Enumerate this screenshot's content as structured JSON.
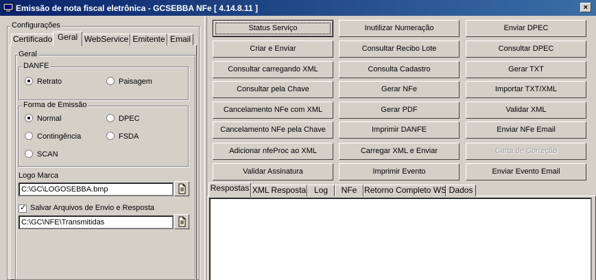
{
  "window": {
    "title": "Emissão de nota fiscal eletrônica - GCSEBBA NFe [ 4.14.8.11 ]",
    "close_glyph": "×"
  },
  "config": {
    "group_label": "Configurações",
    "tabs": [
      "Certificado",
      "Geral",
      "WebService",
      "Emitente",
      "Email"
    ],
    "active_tab": "Geral",
    "geral": {
      "group_label": "Geral",
      "danfe": {
        "label": "DANFE",
        "options": [
          "Retrato",
          "Paisagem"
        ],
        "selected": "Retrato"
      },
      "forma_emissao": {
        "label": "Forma de Emissão",
        "options": [
          "Normal",
          "DPEC",
          "Contingência",
          "FSDA",
          "SCAN"
        ],
        "selected": "Normal"
      },
      "logo_marca": {
        "label": "Logo Marca",
        "value": "C:\\GC\\LOGOSEBBA.bmp"
      },
      "salvar_arquivos": {
        "label": "Salvar Arquivos de Envio e Resposta",
        "checked": true,
        "value": "C:\\GC\\NFE\\Transmitidas"
      }
    }
  },
  "actions": {
    "buttons": [
      "Status Serviço",
      "Inutilizar Numeração",
      "Enviar DPEC",
      "Criar e Enviar",
      "Consultar Recibo Lote",
      "Consultar DPEC",
      "Consultar carregando XML",
      "Consulta Cadastro",
      "Gerar TXT",
      "Consultar pela Chave",
      "Gerar NFe",
      "Importar TXT/XML",
      "Cancelamento NFe com XML",
      "Gerar PDF",
      "Validar XML",
      "Cancelamento NFe pela Chave",
      "Imprimir DANFE",
      "Enviar NFe Email",
      "Adicionar nfeProc ao XML",
      "Carregar XML e Enviar",
      "Carta de Correção",
      "Validar Assinatura",
      "Imprimir Evento",
      "Enviar Evento Email"
    ],
    "disabled": [
      "Carta de Correção"
    ],
    "focused": "Status Serviço"
  },
  "response": {
    "tabs": [
      "Respostas",
      "XML Resposta",
      "Log",
      "NFe",
      "Retorno Completo WS",
      "Dados"
    ],
    "active_tab": "Respostas",
    "content": ""
  },
  "icons": {
    "app": "app-window-icon",
    "browse": "browse-file-icon"
  }
}
